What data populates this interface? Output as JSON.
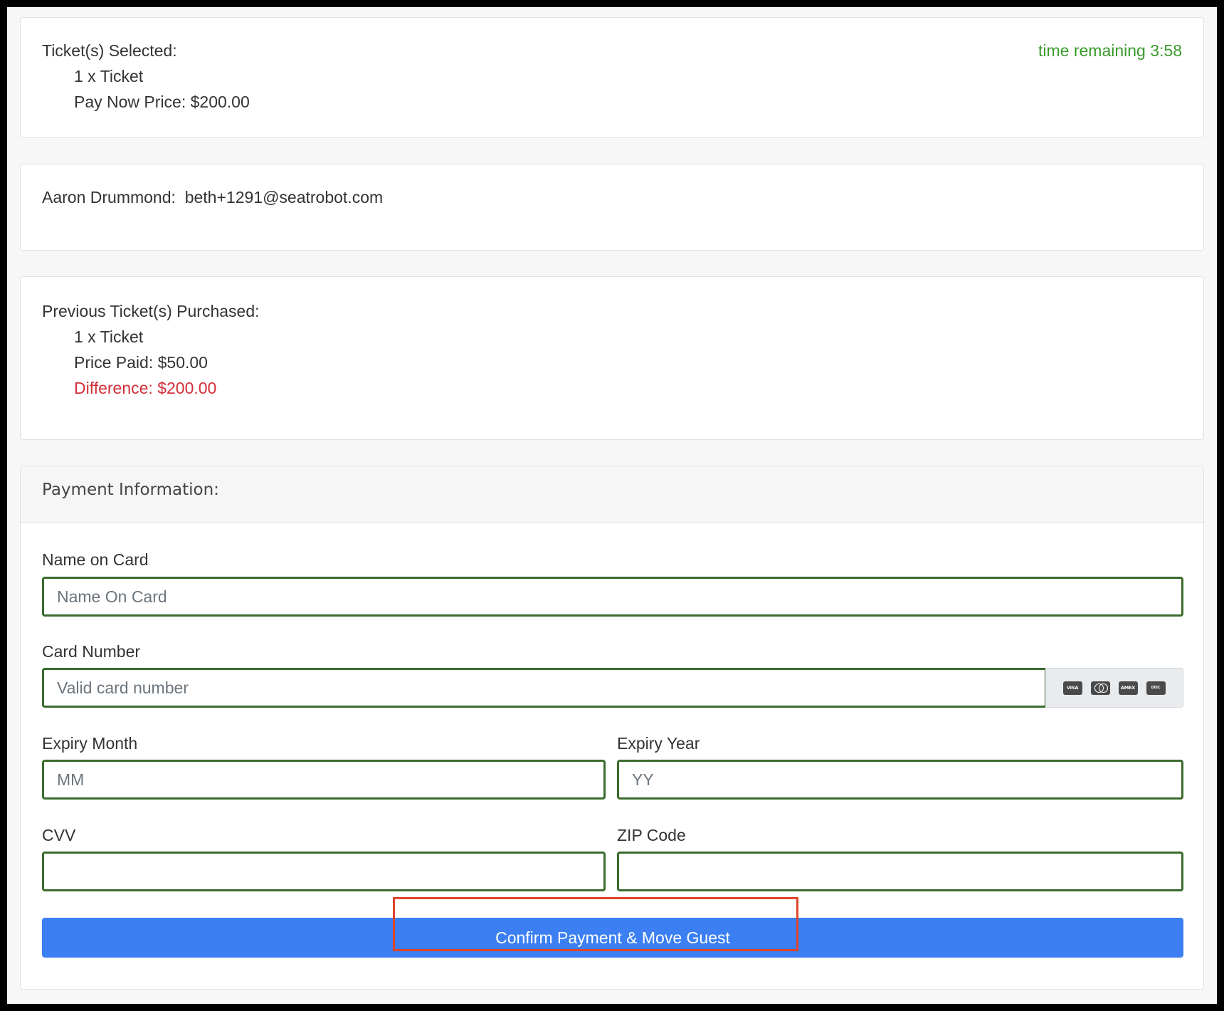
{
  "tickets_selected": {
    "heading": "Ticket(s) Selected:",
    "quantity": "1 x Ticket",
    "price": "Pay Now Price: $200.00",
    "timer": "time remaining 3:58"
  },
  "guest": {
    "name": "Aaron Drummond:",
    "email": "beth+1291@seatrobot.com"
  },
  "previous": {
    "heading": "Previous Ticket(s) Purchased:",
    "quantity": "1 x Ticket",
    "price_paid": "Price Paid: $50.00",
    "difference": "Difference: $200.00"
  },
  "payment": {
    "heading": "Payment Information:",
    "name_label": "Name on Card",
    "name_placeholder": "Name On Card",
    "card_label": "Card Number",
    "card_placeholder": "Valid card number",
    "card_brands": [
      "VISA",
      "MC",
      "AMEX",
      "DISCOVER"
    ],
    "month_label": "Expiry Month",
    "month_placeholder": "MM",
    "year_label": "Expiry Year",
    "year_placeholder": "YY",
    "cvv_label": "CVV",
    "zip_label": "ZIP Code",
    "submit_label": "Confirm Payment & Move Guest"
  },
  "colors": {
    "timer": "#3a9a2c",
    "difference": "#d32f3a",
    "input_border": "#3a6b2c",
    "button": "#3b7ff2",
    "highlight": "#e0442a"
  }
}
